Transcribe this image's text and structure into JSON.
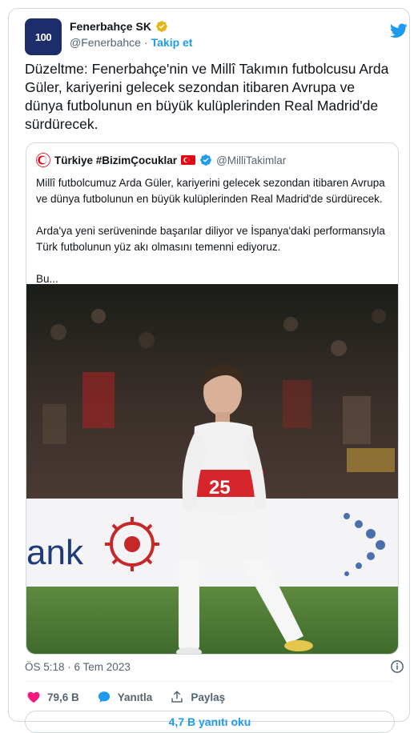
{
  "colors": {
    "accent": "#1d9bf0",
    "like": "#f91880",
    "text": "#0f1419",
    "muted": "#536471",
    "turkey_red": "#e30a17",
    "fb_navy": "#1d2d6b"
  },
  "author": {
    "name": "Fenerbahçe SK",
    "handle": "@Fenerbahce",
    "follow_label": "Takip et",
    "avatar_text": "100"
  },
  "tweet": {
    "text": "Düzeltme: Fenerbahçe'nin ve Millî Takımın futbolcusu Arda\nGüler, kariyerini gelecek sezondan itibaren Avrupa ve\ndünya futbolunun en büyük kulüplerinden Real Madrid'de\nsürdürecek."
  },
  "quote": {
    "name": "Türkiye #BizimÇocuklar",
    "handle": "@MilliTakimlar",
    "text": "Millî futbolcumuz Arda Güler, kariyerini gelecek sezondan itibaren Avrupa\nve dünya futbolunun en büyük kulüplerinden Real Madrid'de sürdürecek.\n\nArda'ya yeni serüveninde başarılar diliyor ve İspanya'daki performansıyla\nTürk futbolunun yüz akı olmasını temenni ediyoruz.\n\nBu...",
    "photo": {
      "jersey_number": "25",
      "board_text": "ank"
    }
  },
  "meta": {
    "timestamp": "ÖS 5:18 · 6 Tem 2023"
  },
  "actions": {
    "like_count": "79,6 B",
    "reply_label": "Yanıtla",
    "share_label": "Paylaş"
  },
  "read_replies_label": "4,7 B yanıtı oku",
  "icons": [
    "verified-badge-icon",
    "twitter-bird-icon",
    "turkey-flag-icon",
    "info-icon",
    "heart-icon",
    "reply-bubble-icon",
    "share-icon"
  ]
}
